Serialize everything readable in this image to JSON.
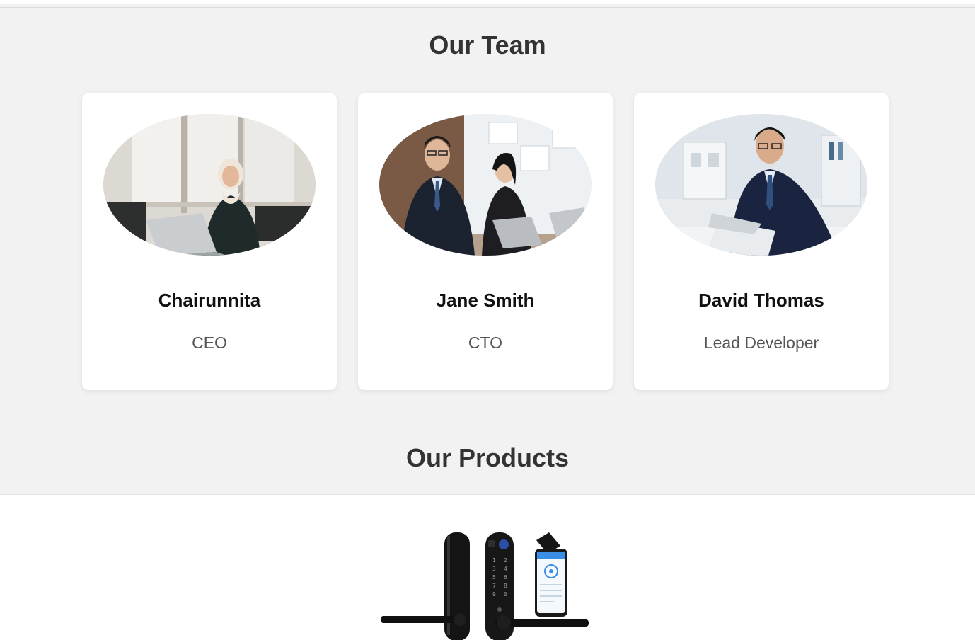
{
  "team": {
    "title": "Our Team",
    "members": [
      {
        "name": "Chairunnita",
        "role": "CEO",
        "photo_icon": "person-at-laptop-photo"
      },
      {
        "name": "Jane Smith",
        "role": "CTO",
        "photo_icon": "two-people-at-laptops-photo"
      },
      {
        "name": "David Thomas",
        "role": "Lead Developer",
        "photo_icon": "man-at-laptop-photo"
      }
    ]
  },
  "products": {
    "title": "Our Products",
    "image_icon": "smart-door-lock-product-image"
  },
  "colors": {
    "background": "#f2f2f2",
    "card": "#ffffff",
    "title": "#333333",
    "name": "#111111",
    "role": "#555555"
  }
}
